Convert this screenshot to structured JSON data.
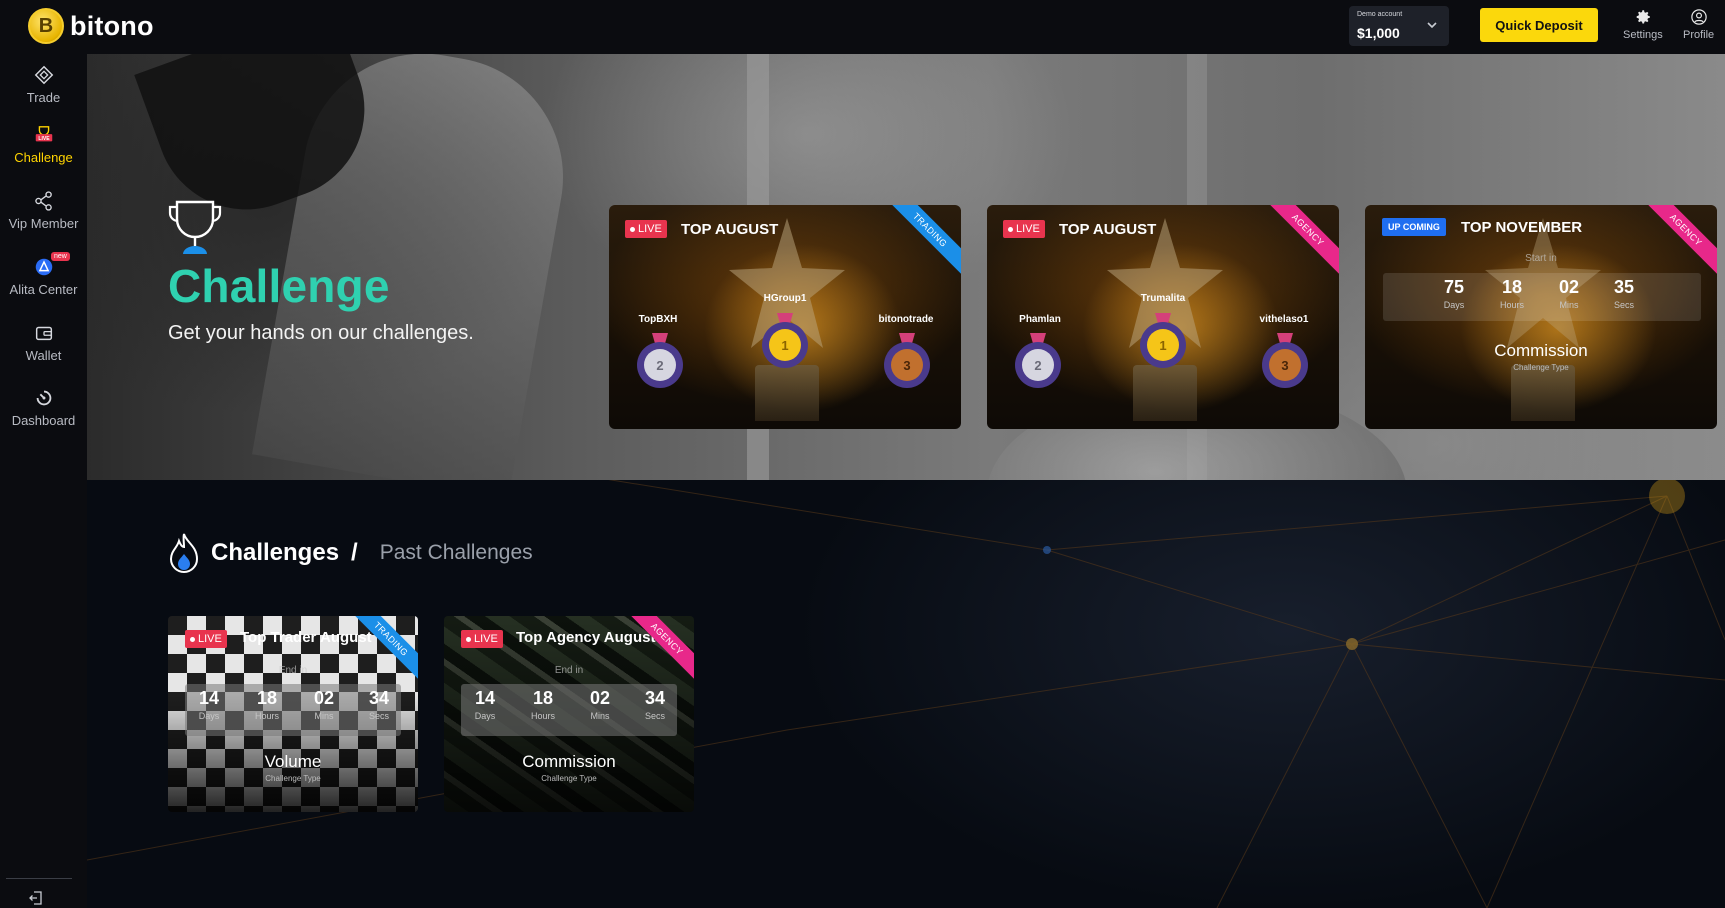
{
  "app": {
    "brand": "bitono",
    "logo_glyph": "B",
    "accent_color": "#fbd80c",
    "challenge_color": "#2fd1b0"
  },
  "topbar": {
    "account_label": "Demo account",
    "account_value": "$1,000",
    "deposit_label": "Quick Deposit",
    "settings_label": "Settings",
    "profile_label": "Profile"
  },
  "sidebar": {
    "items": [
      {
        "label": "Trade",
        "icon": "trade-icon"
      },
      {
        "label": "Challenge",
        "icon": "trophy-live-icon",
        "badge": "LIVE",
        "active": true
      },
      {
        "label": "Vip Member",
        "icon": "share-icon"
      },
      {
        "label": "Alita Center",
        "icon": "alita-icon",
        "badge": "new"
      },
      {
        "label": "Wallet",
        "icon": "wallet-icon"
      },
      {
        "label": "Dashboard",
        "icon": "dashboard-icon"
      }
    ]
  },
  "hero": {
    "title": "Challenge",
    "subtitle": "Get your hands on our challenges.",
    "cards": [
      {
        "status": "LIVE",
        "title": "TOP AUGUST",
        "ribbon": "TRADING",
        "winners": {
          "first": "HGroup1",
          "second": "TopBXH",
          "third": "bitonotrade"
        },
        "medals": [
          "1",
          "2",
          "3"
        ]
      },
      {
        "status": "LIVE",
        "title": "TOP AUGUST",
        "ribbon": "AGENCY",
        "winners": {
          "first": "Trumalita",
          "second": "Phamlan",
          "third": "vithelaso1"
        },
        "medals": [
          "1",
          "2",
          "3"
        ]
      },
      {
        "status": "UP COMING",
        "title": "TOP NOVEMBER",
        "ribbon": "AGENCY",
        "countdown_caption": "Start in",
        "countdown": {
          "days": "75",
          "hours": "18",
          "mins": "02",
          "secs": "35"
        },
        "units": {
          "days": "Days",
          "hours": "Hours",
          "mins": "Mins",
          "secs": "Secs"
        },
        "type": "Commission",
        "type_label": "Challenge Type"
      }
    ]
  },
  "section": {
    "title": "Challenges",
    "separator": "/",
    "past_link": "Past Challenges",
    "cards": [
      {
        "status": "LIVE",
        "title": "Top Trader August",
        "ribbon": "TRADING",
        "countdown_caption": "End in",
        "countdown": {
          "days": "14",
          "hours": "18",
          "mins": "02",
          "secs": "34"
        },
        "units": {
          "days": "Days",
          "hours": "Hours",
          "mins": "Mins",
          "secs": "Secs"
        },
        "type": "Volume",
        "type_label": "Challenge Type"
      },
      {
        "status": "LIVE",
        "title": "Top Agency August",
        "ribbon": "AGENCY",
        "countdown_caption": "End in",
        "countdown": {
          "days": "14",
          "hours": "18",
          "mins": "02",
          "secs": "34"
        },
        "units": {
          "days": "Days",
          "hours": "Hours",
          "mins": "Mins",
          "secs": "Secs"
        },
        "type": "Commission",
        "type_label": "Challenge Type"
      }
    ]
  },
  "colors": {
    "live": "#e8344e",
    "upcoming": "#1f6ef0",
    "ribbon_trading": "#1b8fe8",
    "ribbon_agency": "#e8288a"
  }
}
